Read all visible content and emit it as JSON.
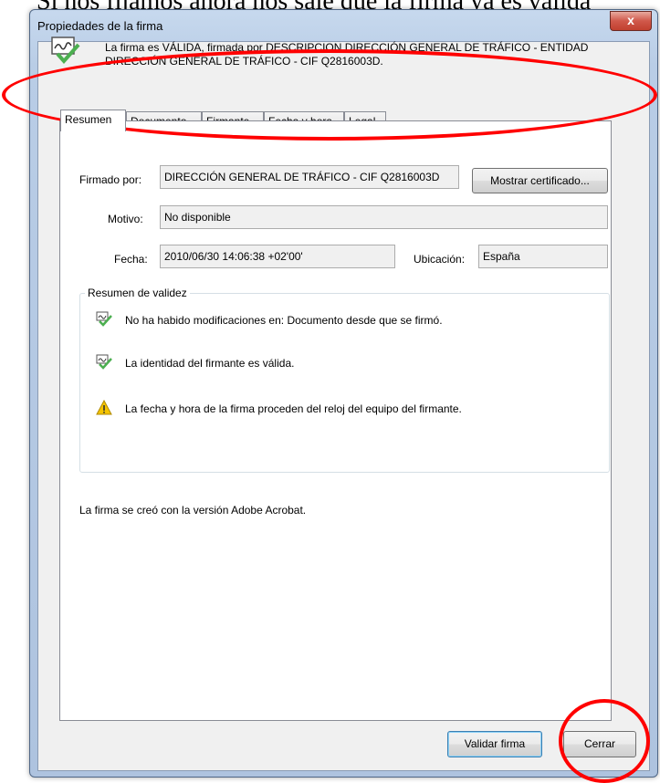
{
  "document_above_text": "Si nos fijamos ahora nos sale que la firma ya es válida",
  "window": {
    "title": "Propiedades de la firma",
    "close_glyph": "x"
  },
  "banner": {
    "line1": "La firma es VÁLIDA, firmada por DESCRIPCION DIRECCIÓN GENERAL DE TRÁFICO - ENTIDAD",
    "line2": "DIRECCIÓN GENERAL DE TRÁFICO - CIF Q2816003D.",
    "icon": "signature-valid-icon"
  },
  "tabs": [
    {
      "label": "Resumen",
      "active": true
    },
    {
      "label": "Documento",
      "active": false
    },
    {
      "label": "Firmante",
      "active": false
    },
    {
      "label": "Fecha y hora",
      "active": false
    },
    {
      "label": "Legal",
      "active": false
    }
  ],
  "fields": {
    "signed_by_label": "Firmado por:",
    "signed_by_value": "DIRECCIÓN GENERAL DE TRÁFICO - CIF Q2816003D",
    "show_cert_button": "Mostrar certificado...",
    "reason_label": "Motivo:",
    "reason_value": "No disponible",
    "date_label": "Fecha:",
    "date_value": "2010/06/30 14:06:38 +02'00'",
    "location_label": "Ubicación:",
    "location_value": "España"
  },
  "validity": {
    "title": "Resumen de validez",
    "items": [
      {
        "icon": "signature-valid-icon",
        "text": "No ha habido modificaciones en: Documento desde que se firmó."
      },
      {
        "icon": "signature-valid-icon",
        "text": "La identidad del firmante es válida."
      },
      {
        "icon": "warning-icon",
        "text": "La fecha y hora de la firma proceden del reloj del equipo del firmante."
      }
    ]
  },
  "footer_note": "La firma se creó con la versión Adobe Acrobat.",
  "buttons": {
    "validate": "Validar firma",
    "close": "Cerrar"
  },
  "colors": {
    "annotation_red": "#ff0000",
    "check_green": "#4caf50",
    "warning_yellow": "#f5c400"
  }
}
